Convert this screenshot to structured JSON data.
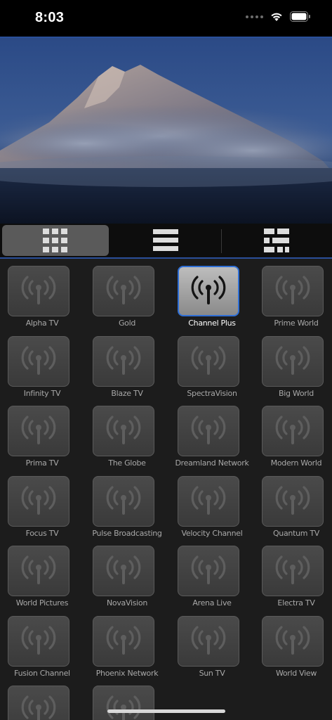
{
  "status_bar": {
    "time": "8:03",
    "icons": [
      "cellular-dots-icon",
      "wifi-icon",
      "battery-icon"
    ]
  },
  "video": {
    "content": "mountain-peak-in-clouds"
  },
  "view_modes": [
    {
      "name": "grid-view",
      "icon": "grid-icon",
      "active": true
    },
    {
      "name": "list-view",
      "icon": "list-icon",
      "active": false
    },
    {
      "name": "compact-view",
      "icon": "compact-grid-icon",
      "active": false
    }
  ],
  "channels": [
    {
      "name": "Alpha TV",
      "selected": false
    },
    {
      "name": "Gold",
      "selected": false
    },
    {
      "name": "Channel Plus",
      "selected": true
    },
    {
      "name": "Prime World",
      "selected": false
    },
    {
      "name": "Infinity TV",
      "selected": false
    },
    {
      "name": "Blaze TV",
      "selected": false
    },
    {
      "name": "SpectraVision",
      "selected": false
    },
    {
      "name": "Big World",
      "selected": false
    },
    {
      "name": "Prima TV",
      "selected": false
    },
    {
      "name": "The Globe",
      "selected": false
    },
    {
      "name": "Dreamland Network",
      "selected": false
    },
    {
      "name": "Modern World",
      "selected": false
    },
    {
      "name": "Focus TV",
      "selected": false
    },
    {
      "name": "Pulse Broadcasting",
      "selected": false
    },
    {
      "name": "Velocity Channel",
      "selected": false
    },
    {
      "name": "Quantum TV",
      "selected": false
    },
    {
      "name": "World Pictures",
      "selected": false
    },
    {
      "name": "NovaVision",
      "selected": false
    },
    {
      "name": "Arena Live",
      "selected": false
    },
    {
      "name": "Electra TV",
      "selected": false
    },
    {
      "name": "Fusion Channel",
      "selected": false
    },
    {
      "name": "Phoenix Network",
      "selected": false
    },
    {
      "name": "Sun TV",
      "selected": false
    },
    {
      "name": "World View",
      "selected": false
    },
    {
      "name": "",
      "selected": false
    },
    {
      "name": "",
      "selected": false
    }
  ],
  "colors": {
    "accent": "#2f6fd6",
    "background": "#1c1c1c",
    "tile": "#424242",
    "tile_selected": "#a8a8a8",
    "label": "#a8a8a8",
    "label_selected": "#ffffff"
  }
}
